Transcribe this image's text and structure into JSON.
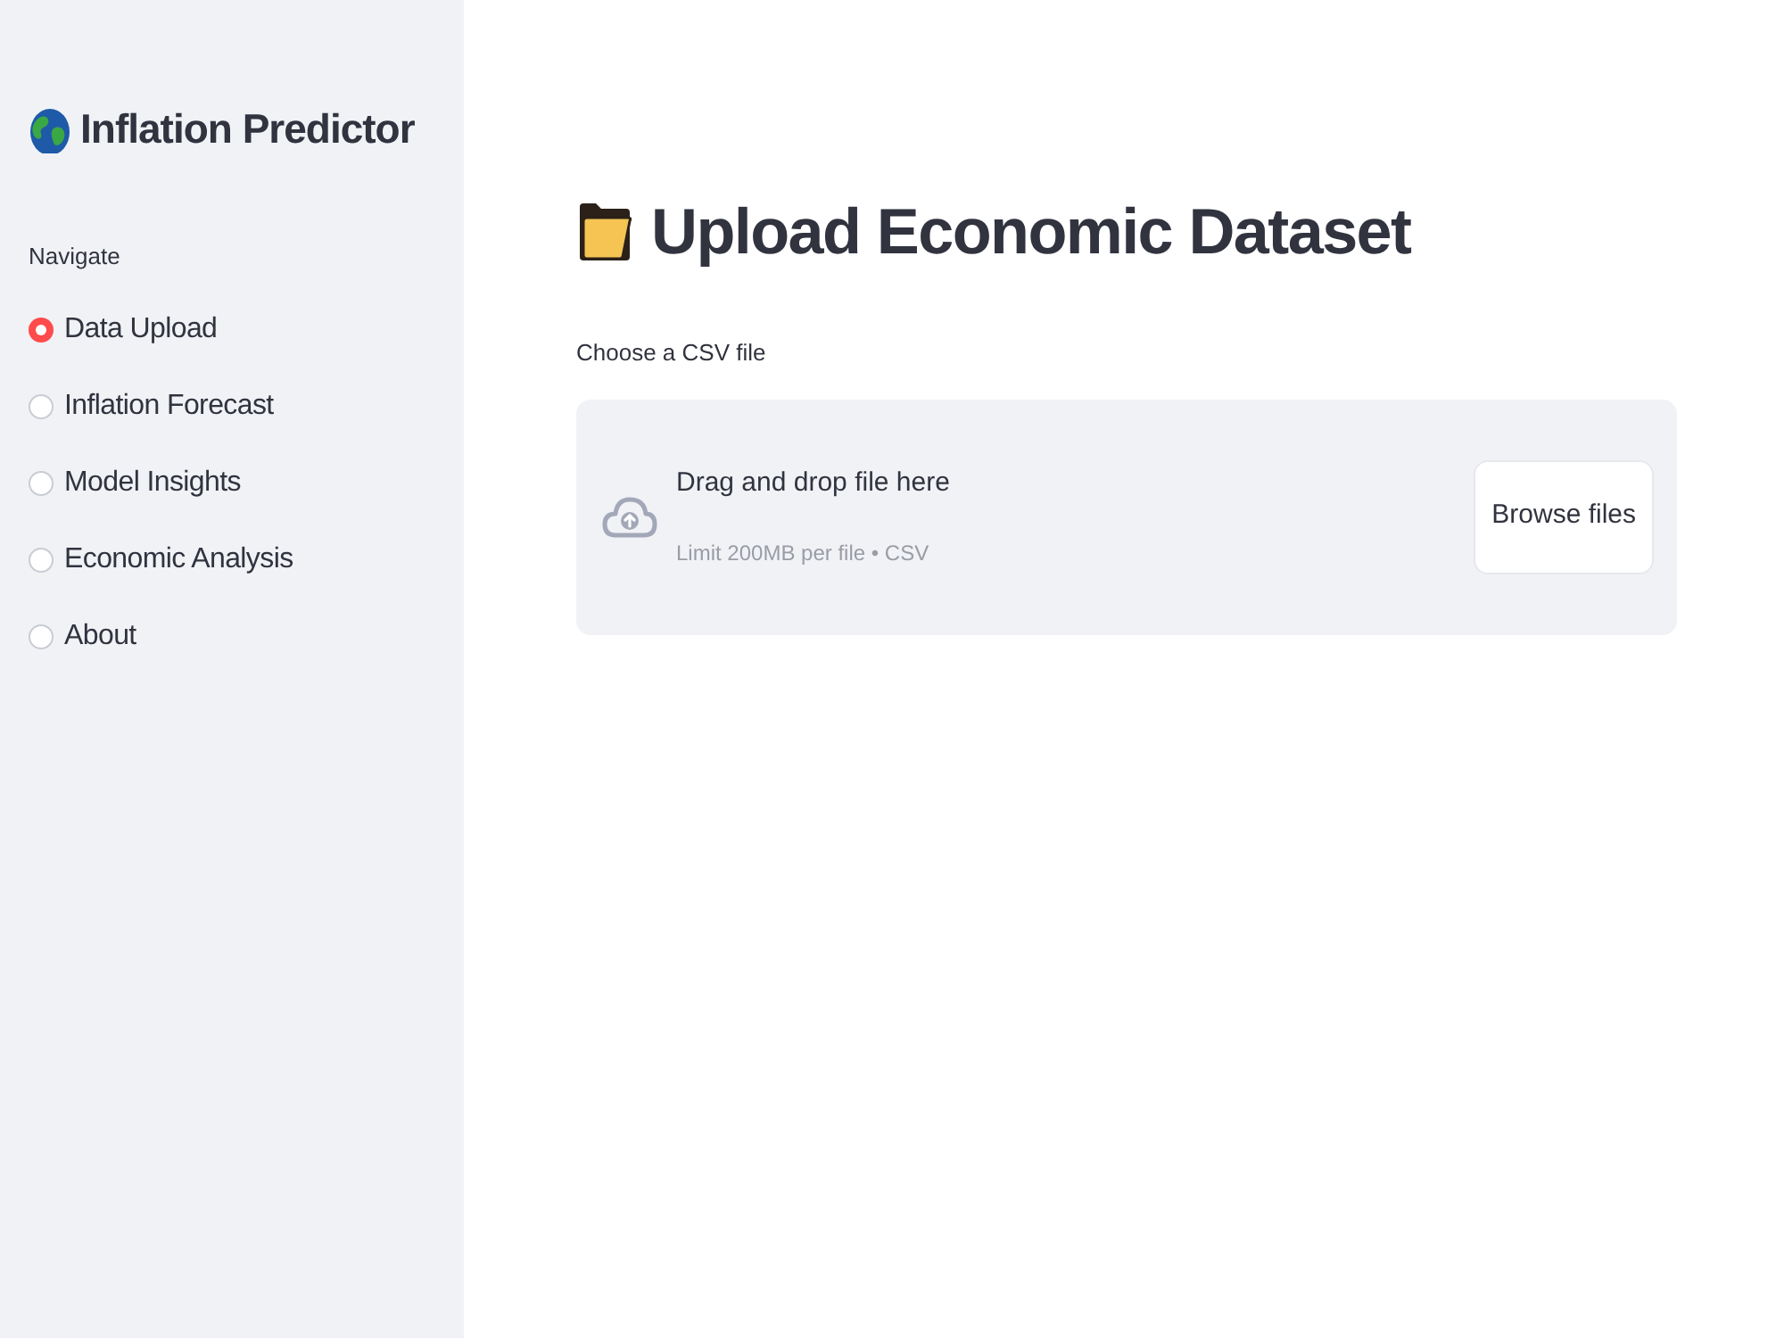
{
  "sidebar": {
    "title": "Inflation Predictor",
    "nav_label": "Navigate",
    "items": [
      {
        "label": "Data Upload",
        "selected": true
      },
      {
        "label": "Inflation Forecast",
        "selected": false
      },
      {
        "label": "Model Insights",
        "selected": false
      },
      {
        "label": "Economic Analysis",
        "selected": false
      },
      {
        "label": "About",
        "selected": false
      }
    ]
  },
  "main": {
    "title": "Upload Economic Dataset",
    "uploader": {
      "label": "Choose a CSV file",
      "instructions": "Drag and drop file here",
      "limit": "Limit 200MB per file • CSV",
      "button": "Browse files"
    }
  }
}
